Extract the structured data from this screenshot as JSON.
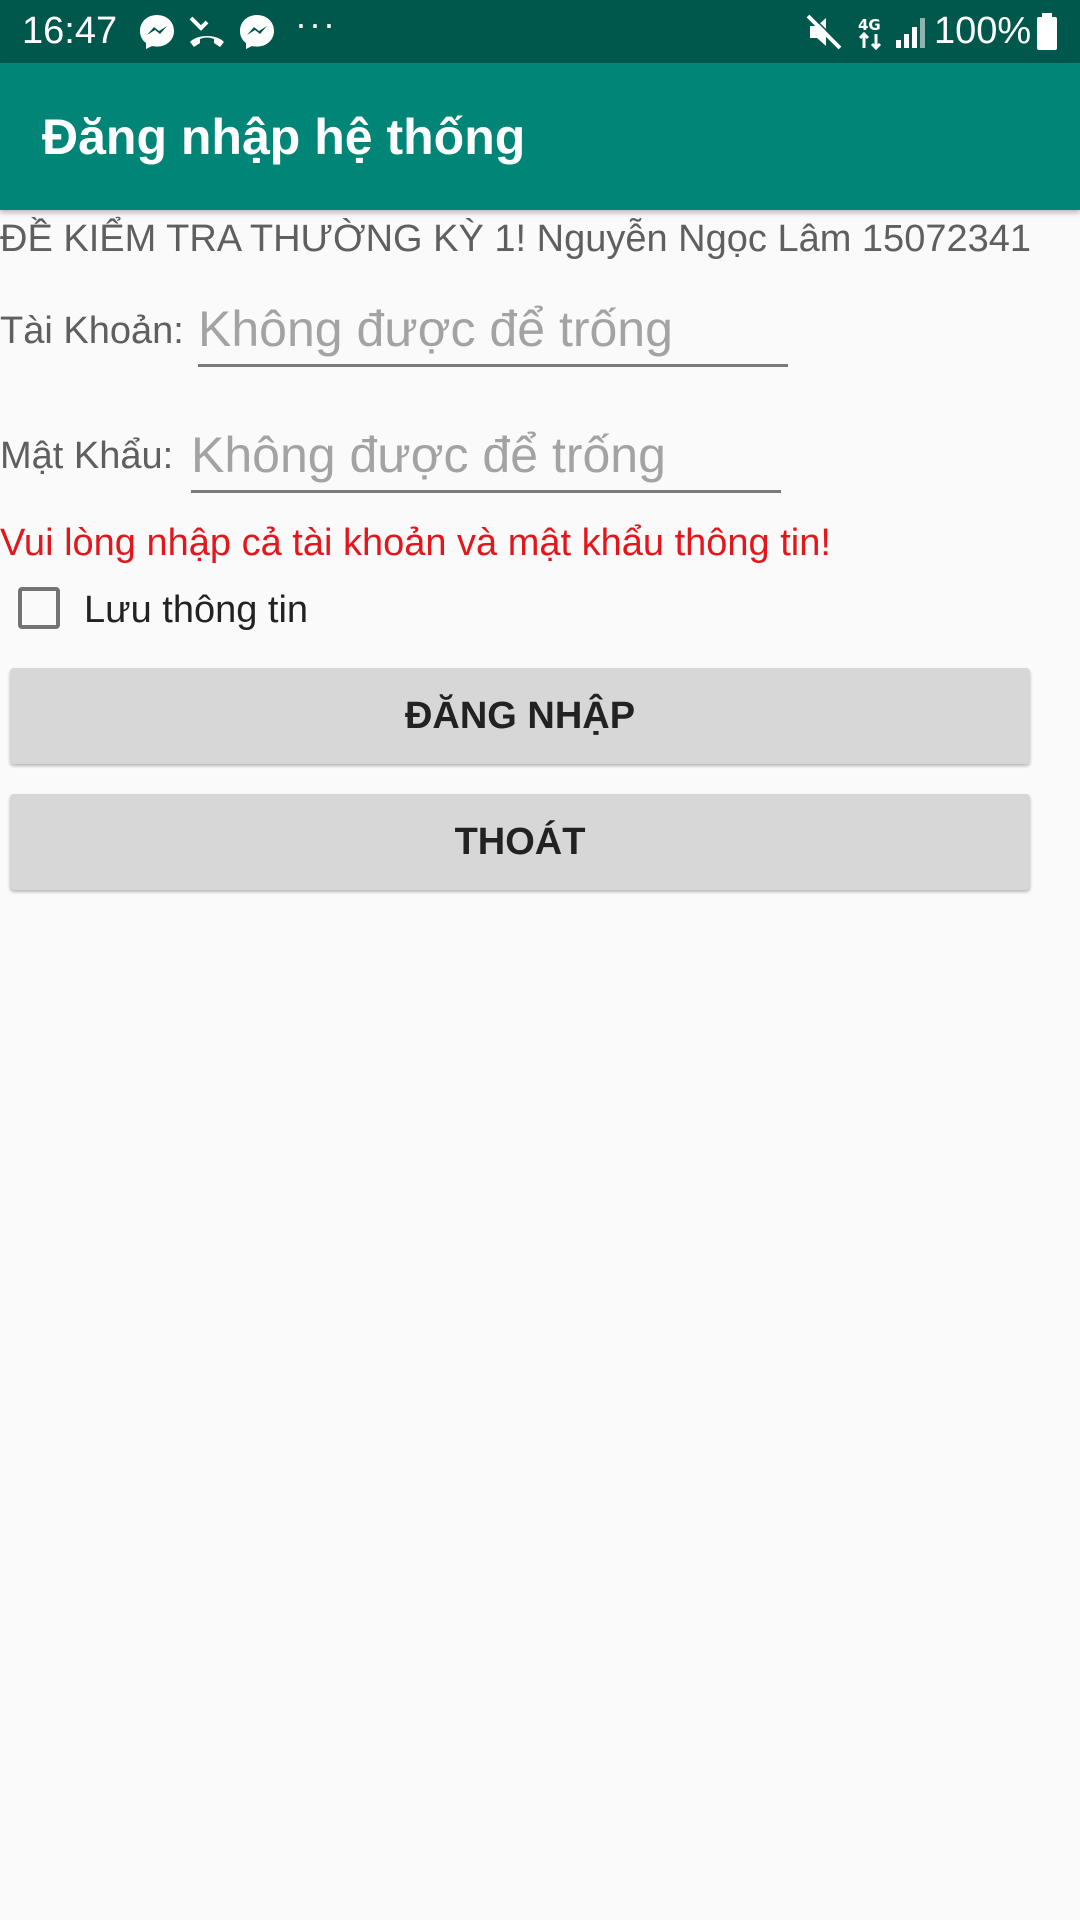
{
  "status_bar": {
    "time": "16:47",
    "dots": "···",
    "battery_text": "100%",
    "icons": [
      "messenger-icon",
      "missed-call-icon",
      "messenger-icon",
      "mute-icon",
      "4g-data-icon",
      "signal-icon",
      "battery-icon"
    ],
    "background": "#00574b"
  },
  "app_bar": {
    "title": "Đăng nhập hệ thống",
    "background": "#008577"
  },
  "main": {
    "exam_title": "ĐỀ KIỂM TRA THƯỜNG KỲ 1! Nguyễn Ngọc Lâm 15072341",
    "account_label": "Tài Khoản:",
    "account_placeholder": "Không được để trống",
    "account_value": "",
    "password_label": "Mật Khẩu:",
    "password_placeholder": "Không được để trống",
    "password_value": "",
    "error_message": "Vui lòng nhập cả tài khoản và mật khẩu thông tin!",
    "error_color": "#e4161c",
    "remember_label": "Lưu thông tin",
    "remember_checked": false,
    "login_button": "ĐĂNG NHẬP",
    "exit_button": "THOÁT"
  }
}
